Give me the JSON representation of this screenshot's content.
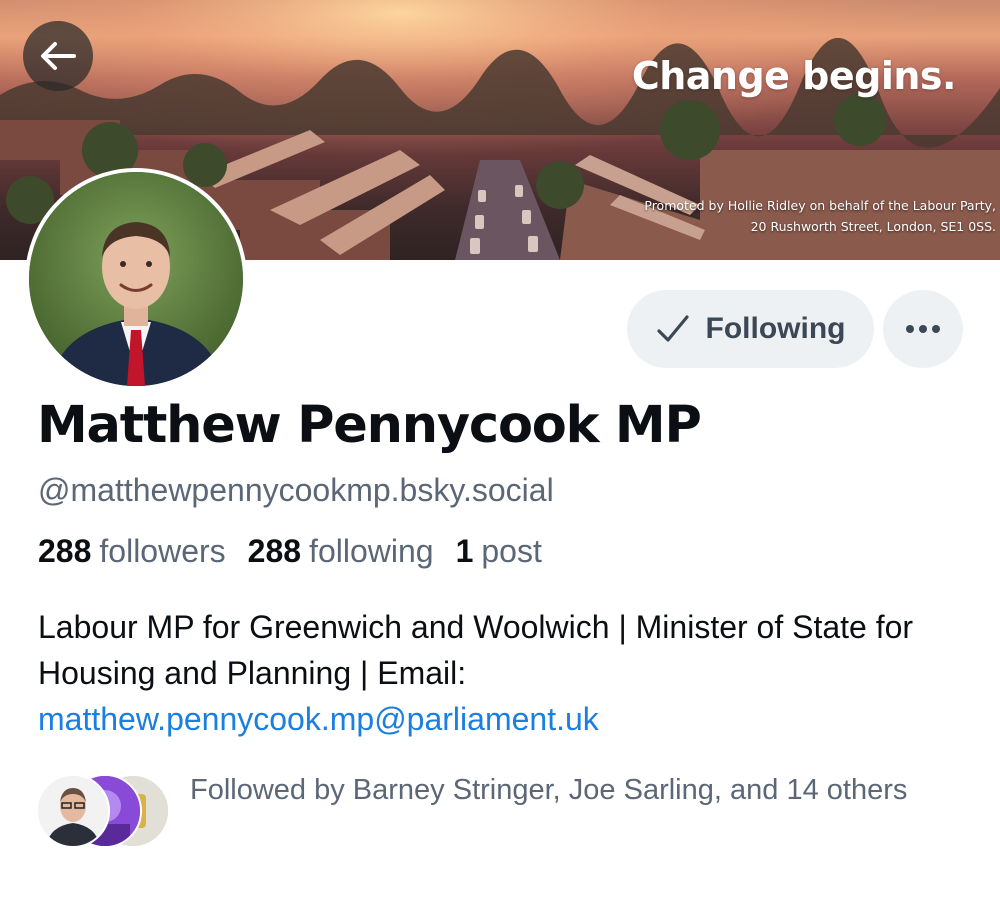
{
  "banner": {
    "headline": "Change begins.",
    "imprint_line1": "Promoted by Hollie Ridley on behalf of the Labour Party,",
    "imprint_line2": "20 Rushworth Street, London, SE1 0SS."
  },
  "nav": {
    "back_icon": "arrow-left-icon"
  },
  "actions": {
    "following_label": "Following",
    "following_icon": "checkmark-icon",
    "more_icon": "ellipsis-icon"
  },
  "profile": {
    "display_name": "Matthew Pennycook MP",
    "handle": "@matthewpennycookmp.bsky.social",
    "stats": {
      "followers_count": "288",
      "followers_label": "followers",
      "following_count": "288",
      "following_label": "following",
      "posts_count": "1",
      "posts_label": "post"
    },
    "bio_text": "Labour MP for Greenwich and Woolwich | Minister of State for Housing and Planning | Email: ",
    "bio_link": "matthew.pennycook.mp@parliament.uk"
  },
  "followed_by": {
    "text": "Followed by Barney Stringer, Joe Sarling, and 14 others"
  },
  "colors": {
    "link": "#1a7fe0",
    "muted_text": "#5b6776",
    "button_bg": "#eef1f4",
    "primary_text": "#0b0f14"
  }
}
